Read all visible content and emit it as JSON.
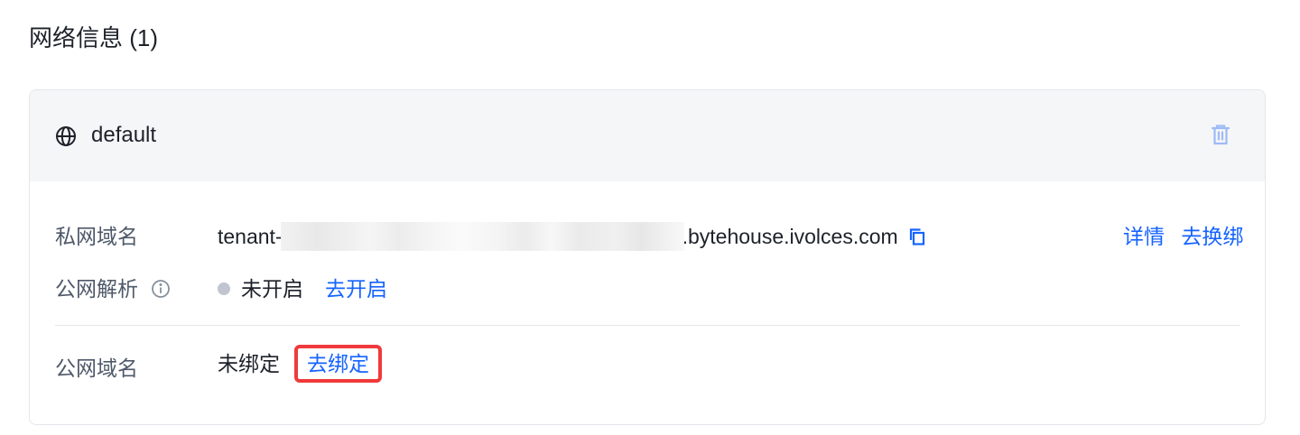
{
  "section": {
    "title": "网络信息 (1)"
  },
  "card": {
    "name": "default",
    "icons": {
      "globe": "globe-icon",
      "delete": "trash-icon",
      "copy": "copy-icon",
      "info": "info-icon"
    },
    "private_domain": {
      "label": "私网域名",
      "value_prefix": "tenant-",
      "value_suffix": ".bytehouse.ivolces.com",
      "detail_link": "详情",
      "rebind_link": "去换绑"
    },
    "public_resolution": {
      "label": "公网解析",
      "status": "未开启",
      "enable_link": "去开启",
      "status_color": "#c0c5cf"
    },
    "public_domain": {
      "label": "公网域名",
      "status": "未绑定",
      "bind_link": "去绑定",
      "highlight_color": "#f0393b"
    }
  },
  "colors": {
    "link": "#1664ff",
    "header_bg": "#f5f6f8",
    "label": "#4e5969"
  }
}
